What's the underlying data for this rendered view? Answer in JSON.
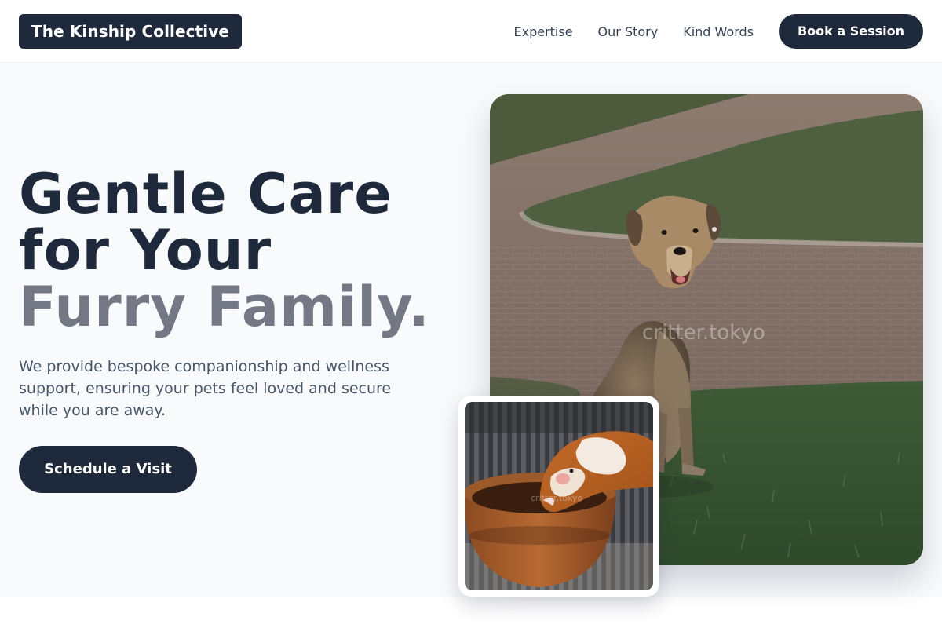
{
  "header": {
    "logo": "The Kinship Collective",
    "nav": [
      "Expertise",
      "Our Story",
      "Kind Words"
    ],
    "cta": "Book a Session"
  },
  "hero": {
    "headline_line1": "Gentle Care",
    "headline_line2": "for Your",
    "headline_line3": "Furry Family.",
    "subtext": "We provide bespoke companionship and wellness support, ensuring your pets feel loved and secure while you are away.",
    "cta": "Schedule a Visit"
  },
  "images": {
    "main_watermark": "critter.tokyo",
    "inset_watermark": "critter.tokyo"
  },
  "colors": {
    "primary": "#1e293b",
    "muted_heading": "#737884",
    "body_text": "#475569",
    "hero_bg": "#f8fafc"
  }
}
